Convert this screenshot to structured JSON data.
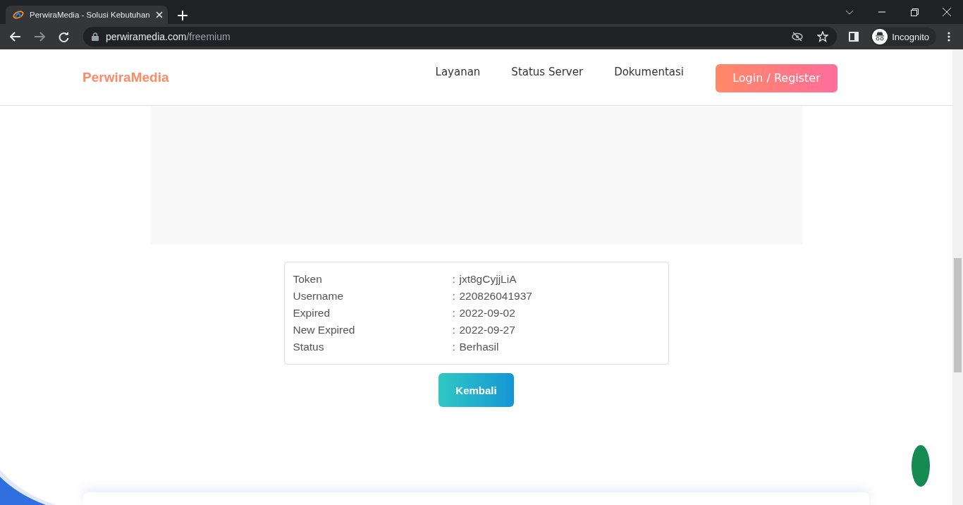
{
  "browser": {
    "tab_title": "PerwiraMedia - Solusi Kebutuhan",
    "url_host": "perwiramedia.com",
    "url_path": "/freemium",
    "profile": "Incognito"
  },
  "header": {
    "logo": "PerwiraMedia",
    "nav": [
      "Layanan",
      "Status Server",
      "Dokumentasi"
    ],
    "cta": "Login / Register"
  },
  "details": [
    {
      "label": "Token",
      "separator": ":",
      "value": "jxt8gCyjjLiA"
    },
    {
      "label": "Username",
      "separator": ":",
      "value": "220826041937"
    },
    {
      "label": "Expired",
      "separator": ":",
      "value": "2022-09-02"
    },
    {
      "label": "New Expired",
      "separator": ":",
      "value": "2022-09-27"
    },
    {
      "label": "Status",
      "separator": ":",
      "value": "Berhasil"
    }
  ],
  "back_button": "Kembali"
}
